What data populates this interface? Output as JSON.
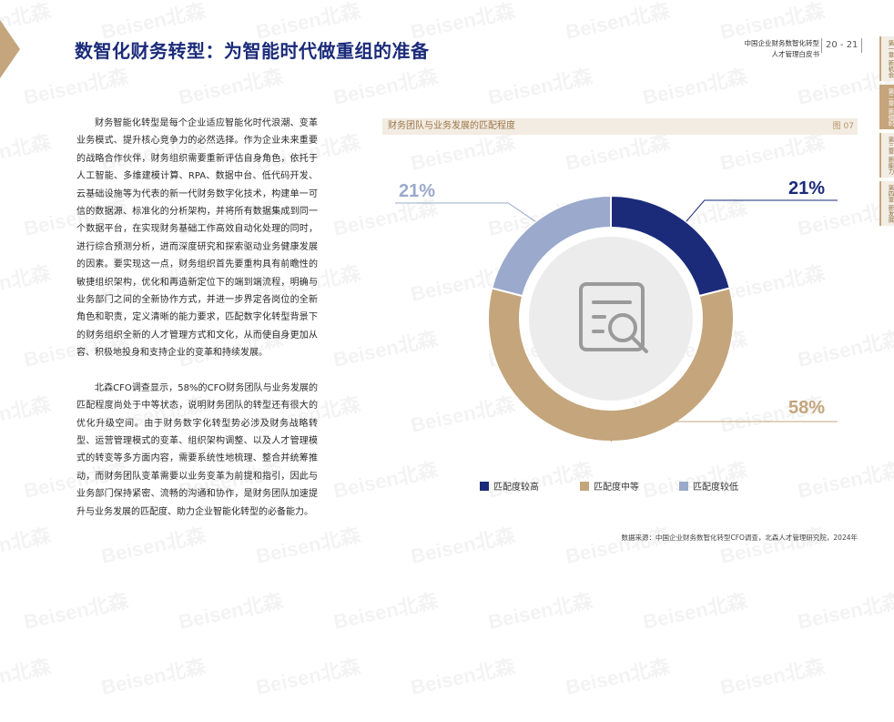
{
  "page": {
    "title": "数智化财务转型：为智能时代做重组的准备",
    "doc_title_line1": "中国企业财务数智化转型",
    "doc_title_line2": "人才管理白皮书",
    "page_numbers": "20 - 21",
    "side_tabs": [
      "第一章 新机会",
      "第二章 新组织",
      "第三章 新能力",
      "第四章 新发展"
    ],
    "watermark": "Beisen北森",
    "accent_color": "#c4a57c",
    "title_color": "#1b2b7a"
  },
  "body": {
    "paragraphs": [
      "财务智能化转型是每个企业适应智能化时代浪潮、变革业务模式、提升核心竞争力的必然选择。作为企业未来重要的战略合作伙伴，财务组织需要重新评估自身角色，依托于人工智能、多维建模计算、RPA、数据中台、低代码开发、云基础设施等为代表的新一代财务数字化技术，构建单一可信的数据源、标准化的分析架构，并将所有数据集成到同一个数据平台，在实现财务基础工作高效自动化处理的同时，进行综合预测分析，进而深度研究和探索驱动业务健康发展的因素。要实现这一点，财务组织首先要重构具有前瞻性的敏捷组织架构，优化和再造新定位下的端到端流程，明确与业务部门之间的全新协作方式，并进一步界定各岗位的全新角色和职责，定义清晰的能力要求，匹配数字化转型背景下的财务组织全新的人才管理方式和文化，从而使自身更加从容、积极地投身和支持企业的变革和持续发展。",
      "北森CFO调查显示，58%的CFO财务团队与业务发展的匹配程度尚处于中等状态，说明财务团队的转型还有很大的优化升级空间。由于财务数字化转型势必涉及财务战略转型、运营管理模式的变革、组织架构调整、以及人才管理模式的转变等多方面内容，需要系统性地梳理、整合并统筹推动，而财务团队变革需要以业务变革为前提和指引，因此与业务部门保持紧密、流畅的沟通和协作，是财务团队加速提升与业务发展的匹配度、助力企业智能化转型的必备能力。"
    ]
  },
  "chart_data": {
    "type": "pie",
    "title": "财务团队与业务发展的匹配程度",
    "figure_label": "图 07",
    "categories": [
      "匹配度较高",
      "匹配度中等",
      "匹配度较低"
    ],
    "values": [
      21,
      58,
      21
    ],
    "labels": [
      "21%",
      "58%",
      "21%"
    ],
    "colors": [
      "#1b2b7a",
      "#c4a57c",
      "#9aa9cc"
    ],
    "donut": true,
    "legend_position": "bottom",
    "center_icon": "document-search-icon"
  },
  "source": "数据来源：中国企业财务数智化转型CFO调查，北森人才管理研究院，2024年"
}
